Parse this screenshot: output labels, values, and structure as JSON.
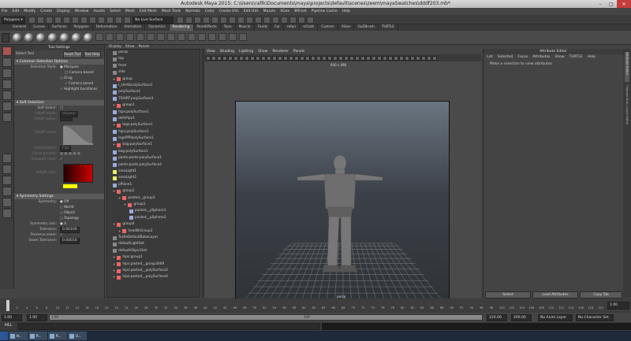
{
  "window": {
    "title": "Autodesk Maya 2015: C:\\Users\\rafik\\Documents\\maya\\projects\\default\\scenes\\zeem\\mayaSwatches\\dddf203.mb*"
  },
  "menu": [
    "File",
    "Edit",
    "Modify",
    "Create",
    "Display",
    "Window",
    "Assets",
    "Select",
    "Mesh",
    "Edit Mesh",
    "Mesh Tools",
    "Normals",
    "Color",
    "Create UVs",
    "Edit UVs",
    "Muscle",
    "XGen",
    "BIFrost",
    "Pipeline Cache",
    "Help"
  ],
  "status": {
    "mode": "Polygons",
    "live_surface": "No Live Surface"
  },
  "shelf_tabs": [
    "General",
    "Curves",
    "Surfaces",
    "Polygons",
    "Deformation",
    "Animation",
    "Dynamics",
    "Rendering",
    "PaintEffects",
    "Toon",
    "Muscle",
    "Fluids",
    "Fur",
    "nHair",
    "nCloth",
    "Custom",
    "XGen",
    "GoZBrush",
    "TURTLE"
  ],
  "shelf_active": "Rendering",
  "tool_settings": {
    "panel_title": "Tool Settings",
    "tool_name": "Select Tool",
    "reset_label": "Reset Tool",
    "help_label": "Tool Help",
    "common_header": "Common Selection Options",
    "selection_style_label": "Selection Style:",
    "style_options": [
      "Marquee",
      "Camera based",
      "Drag",
      "Camera based",
      "Highlight backfaces"
    ],
    "soft_header": "Soft Selection",
    "soft_select_label": "Soft Select:",
    "falloff_mode_label": "Falloff mode:",
    "falloff_mode_value": "Volume",
    "falloff_radius_label": "Falloff radius:",
    "falloff_curve_label": "Falloff curve:",
    "interpolation_label": "Interpolation:",
    "interpolation_value": "Flat",
    "curve_presets_label": "Curve presets:",
    "viewport_color_label": "Viewport color:",
    "falloff_color_label": "Falloff color:",
    "symmetry_header": "Symmetry Settings",
    "symmetry_label": "Symmetry:",
    "symmetry_options": [
      "Off",
      "World",
      "Object",
      "Topology"
    ],
    "sym_axis_label": "Symmetry axis:",
    "sym_axis_value": "X",
    "tolerance_label": "Tolerance:",
    "tolerance_value": "0.00100",
    "preserve_seam_label": "Preserve seam:",
    "seam_tol_label": "Seam Tolerance:",
    "seam_tol_value": "0.00010"
  },
  "outliner": {
    "menu": [
      "Display",
      "Show",
      "Panels"
    ],
    "items": [
      {
        "label": "persp",
        "type": "cam",
        "indent": 1
      },
      {
        "label": "top",
        "type": "cam",
        "indent": 1
      },
      {
        "label": "front",
        "type": "cam",
        "indent": 1
      },
      {
        "label": "side",
        "type": "cam",
        "indent": 1
      },
      {
        "label": "group",
        "type": "grp",
        "indent": 1
      },
      {
        "label": "l_shirtbcolySurface1",
        "type": "mesh",
        "indent": 1
      },
      {
        "label": "polySurface1",
        "type": "mesh",
        "indent": 1
      },
      {
        "label": "TSHIRT:polySurface3",
        "type": "mesh",
        "indent": 1
      },
      {
        "label": "group1",
        "type": "grp",
        "indent": 1
      },
      {
        "label": "hips:polySurface1",
        "type": "mesh",
        "indent": 1
      },
      {
        "label": "defsPipe1",
        "type": "mesh",
        "indent": 1
      },
      {
        "label": "legs:polySurface1",
        "type": "grp",
        "indent": 1
      },
      {
        "label": "hips:polySurface1",
        "type": "mesh",
        "indent": 1
      },
      {
        "label": "legsPPPpolySurface1",
        "type": "mesh",
        "indent": 1
      },
      {
        "label": "bag:polySurface1",
        "type": "grp",
        "indent": 1
      },
      {
        "label": "bag:polySurface1",
        "type": "mesh",
        "indent": 1
      },
      {
        "label": "pants:pants:polySurface1",
        "type": "mesh",
        "indent": 1
      },
      {
        "label": "pants:pants:polySurface2",
        "type": "mesh",
        "indent": 1
      },
      {
        "label": "areaLight1",
        "type": "light",
        "indent": 1
      },
      {
        "label": "areaLight2",
        "type": "light",
        "indent": 1
      },
      {
        "label": "pPlane1",
        "type": "mesh",
        "indent": 1
      },
      {
        "label": "group2",
        "type": "grp",
        "indent": 1
      },
      {
        "label": "pasted__group3",
        "type": "grp",
        "indent": 2
      },
      {
        "label": "group1",
        "type": "grp",
        "indent": 3
      },
      {
        "label": "pasted__pSphere1",
        "type": "mesh",
        "indent": 4
      },
      {
        "label": "pasted__pSphere2",
        "type": "mesh",
        "indent": 4
      },
      {
        "label": "group4",
        "type": "grp",
        "indent": 1
      },
      {
        "label": "headBrGroup2",
        "type": "grp",
        "indent": 2
      },
      {
        "label": "TurtleDefaultBakeLayer",
        "type": "cam",
        "indent": 1
      },
      {
        "label": "defaultLightSet",
        "type": "cam",
        "indent": 1
      },
      {
        "label": "defaultObjectSet",
        "type": "cam",
        "indent": 1
      },
      {
        "label": "hips:group1",
        "type": "grp",
        "indent": 1
      },
      {
        "label": "hips:pasted__group3009",
        "type": "grp",
        "indent": 1
      },
      {
        "label": "hips:pasted__polySurface2",
        "type": "grp",
        "indent": 1
      },
      {
        "label": "hips:pasted__polySurface4",
        "type": "grp",
        "indent": 1
      }
    ]
  },
  "viewport": {
    "menu": [
      "View",
      "Shading",
      "Lighting",
      "Show",
      "Renderer",
      "Panels"
    ],
    "resolution": "640 x 480",
    "camera": "persp"
  },
  "attribute_editor": {
    "title": "Attribute Editor",
    "menu": [
      "List",
      "Selected",
      "Focus",
      "Attributes",
      "Show",
      "TURTLE",
      "Help"
    ],
    "message": "Make a selection to view attributes",
    "select_label": "Select",
    "load_label": "Load Attributes",
    "copy_label": "Copy Tab"
  },
  "side_tabs": [
    "Attribute Editor",
    "Channel Box / Layer Editor"
  ],
  "timeline": {
    "ticks": [
      "1",
      "2",
      "4",
      "6",
      "8",
      "10",
      "12",
      "14",
      "16",
      "18",
      "20",
      "22",
      "24",
      "26",
      "28",
      "30",
      "32",
      "34",
      "36",
      "38",
      "40",
      "42",
      "44",
      "46",
      "48",
      "50",
      "52",
      "54",
      "56",
      "58",
      "60",
      "62",
      "64",
      "66",
      "68",
      "70",
      "72",
      "74",
      "76",
      "78",
      "80",
      "82",
      "84",
      "86",
      "88",
      "90",
      "92",
      "94",
      "96",
      "98",
      "100",
      "102",
      "104",
      "106",
      "108",
      "110",
      "112",
      "114",
      "116",
      "118",
      "120"
    ],
    "current_frame": "1.00"
  },
  "range": {
    "start": "1.00",
    "range_start": "1.00",
    "range_end_inner": "120",
    "end": "120.00",
    "anim_end": "200.00",
    "anim_layer": "No Anim Layer",
    "character_set": "No Character Set"
  },
  "cmd": {
    "label": "MEL"
  },
  "taskbar": [
    "H...",
    "R...",
    "R...",
    "U..."
  ]
}
